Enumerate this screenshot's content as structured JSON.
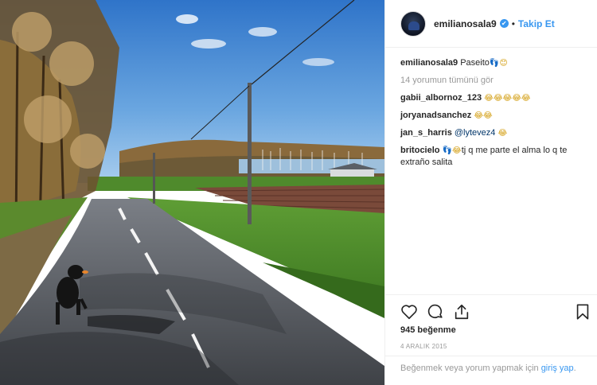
{
  "header": {
    "username": "emilianosala9",
    "verified_icon": "✔",
    "separator": "•",
    "follow_label": "Takip Et"
  },
  "caption": {
    "user": "emilianosala9",
    "text": "Paseito",
    "emoji": "👣😊"
  },
  "view_all": "14 yorumun tümünü gör",
  "comments": [
    {
      "user": "gabii_albornoz_123",
      "text": "",
      "mention": "",
      "emoji": "😂😂😂😂😂"
    },
    {
      "user": "joryanadsanchez",
      "text": "",
      "mention": "",
      "emoji": "😂😂"
    },
    {
      "user": "jan_s_harris",
      "text": "",
      "mention": "@lytevez4",
      "emoji": "😂"
    },
    {
      "user": "britocielo",
      "text": "tj q me parte el alma lo q te extraño salita",
      "mention": "",
      "emoji": "👣😂"
    }
  ],
  "actions": {
    "like_icon": "heart-icon",
    "comment_icon": "comment-icon",
    "share_icon": "share-icon",
    "save_icon": "bookmark-icon"
  },
  "likes": "945 beğenme",
  "date": "4 ARALIK 2015",
  "login_prompt": {
    "text": "Beğenmek veya yorum yapmak için ",
    "link": "giriş yap",
    "suffix": "."
  },
  "colors": {
    "accent": "#3897f0",
    "muted": "#999999",
    "text": "#262626",
    "border": "#efefef"
  }
}
